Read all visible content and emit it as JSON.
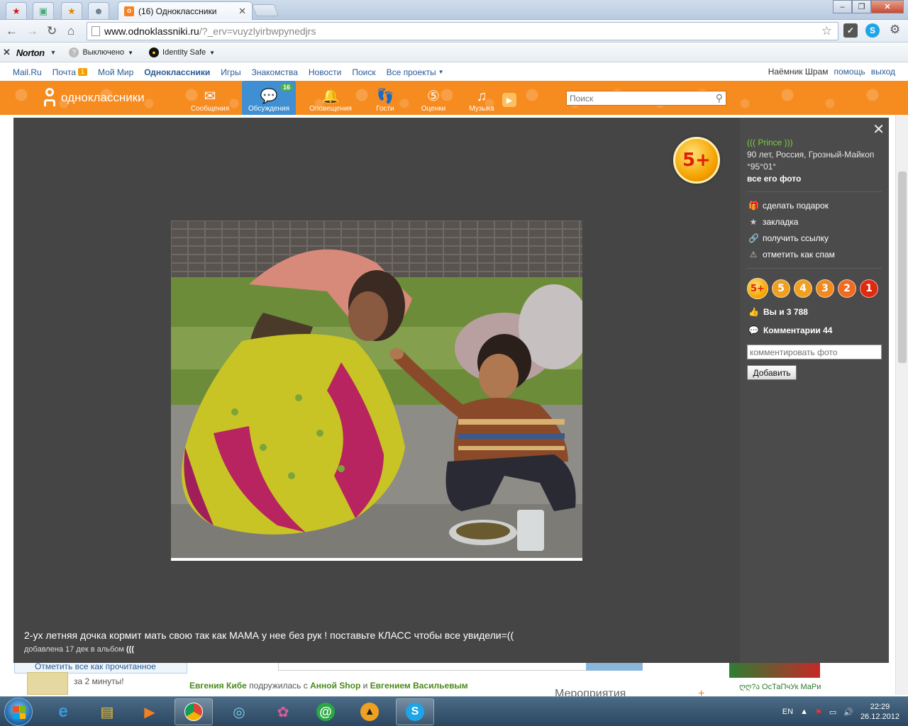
{
  "browser": {
    "active_tab_title": "(16) Одноклассники",
    "url_host": "www.odnoklassniki.ru",
    "url_path": "/?_erv=vuyzlyirbwpynedjrs"
  },
  "norton": {
    "logo": "Norton",
    "status_label": "Выключено",
    "identity_label": "Identity Safe"
  },
  "toplinks": {
    "items": [
      "Mail.Ru",
      "Почта",
      "Мой Мир",
      "Одноклассники",
      "Игры",
      "Знакомства",
      "Новости",
      "Поиск",
      "Все проекты"
    ],
    "mail_badge": "1",
    "user": "Наёмник Шрам",
    "help": "помощь",
    "logout": "выход"
  },
  "okbar": {
    "logo_text": "одноклассники",
    "nav": [
      {
        "label": "Сообщения",
        "icon": "envelope-icon"
      },
      {
        "label": "Обсуждения",
        "icon": "chat-icon",
        "badge": "16"
      },
      {
        "label": "Оповещения",
        "icon": "bell-icon"
      },
      {
        "label": "Гости",
        "icon": "footprints-icon"
      },
      {
        "label": "Оценки",
        "icon": "rating-icon"
      },
      {
        "label": "Музыка",
        "icon": "music-icon"
      }
    ],
    "search_placeholder": "Поиск"
  },
  "background": {
    "mark_read": "Отметить все как прочитанное",
    "promo": "за 2 минуты!",
    "feed_line_1": "Евгения Кибе",
    "feed_line_2": "подружилась с",
    "feed_line_3": "Анной Shop",
    "feed_line_4": "и",
    "feed_line_5": "Евгением Васильевым",
    "events": "Мероприятия",
    "right_user": "ღღ?ა ОсТаПчУк МаРи"
  },
  "photo_viewer": {
    "rating_badge": "5+",
    "caption": "2-ух летняя дочка кормит мать свою так как МАМА у нее без рук ! поставьте КЛАСС чтобы все увидели=((",
    "added_prefix": "добавлена 17 дек в альбом",
    "album": "(((",
    "author": "((( Prince )))",
    "author_info": "90 лет, Россия, Грозный-Майкоп",
    "author_extra": "°95°01°",
    "all_photos": "все его фото",
    "actions": [
      {
        "label": "сделать подарок",
        "icon": "gift-icon"
      },
      {
        "label": "закладка",
        "icon": "star-icon"
      },
      {
        "label": "получить ссылку",
        "icon": "link-icon"
      },
      {
        "label": "отметить как спам",
        "icon": "warning-icon"
      }
    ],
    "marks": [
      "5+",
      "5",
      "4",
      "3",
      "2",
      "1"
    ],
    "likes": "Вы и 3 788",
    "comments": "Комментарии 44",
    "comment_placeholder": "комментировать фото",
    "add_button": "Добавить"
  },
  "taskbar": {
    "lang": "EN",
    "time": "22:29",
    "date": "26.12.2012"
  }
}
